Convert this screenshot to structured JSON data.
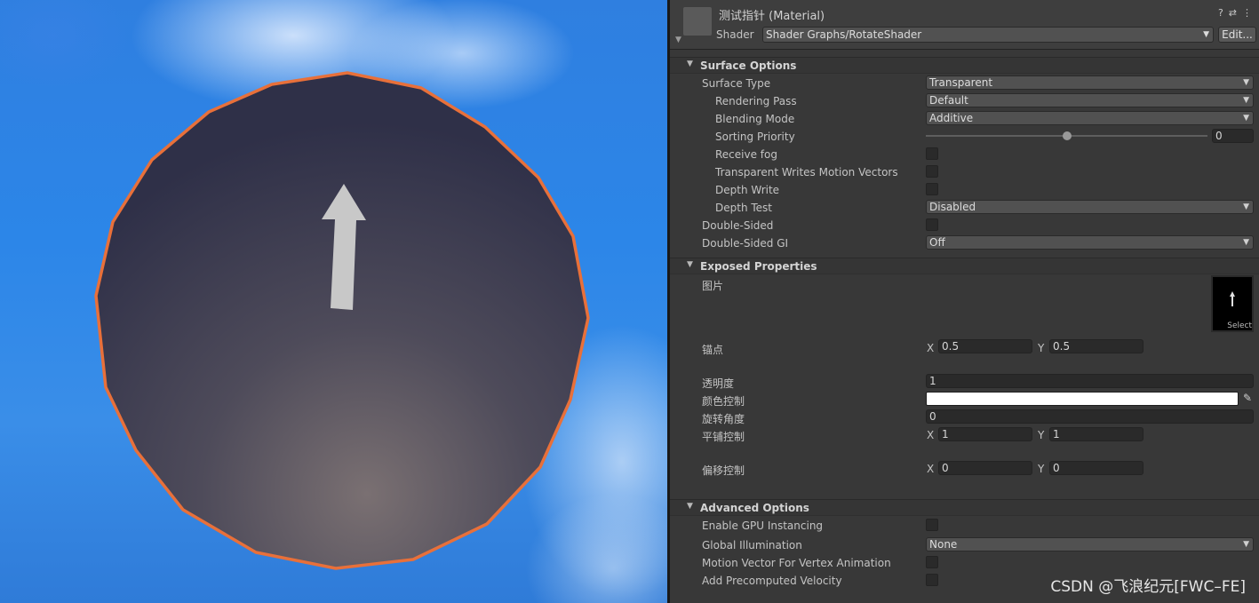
{
  "material": {
    "title": "测试指针 (Material)",
    "shader_label": "Shader",
    "shader_value": "Shader Graphs/RotateShader",
    "edit_label": "Edit...",
    "help_icon": "question-icon",
    "settings_icon": "sliders-icon",
    "menu_icon": "kebab-icon"
  },
  "surface": {
    "title": "Surface Options",
    "surface_type": {
      "label": "Surface Type",
      "value": "Transparent"
    },
    "rendering_pass": {
      "label": "Rendering Pass",
      "value": "Default"
    },
    "blending_mode": {
      "label": "Blending Mode",
      "value": "Additive"
    },
    "sorting_priority": {
      "label": "Sorting Priority",
      "value": "0",
      "slider_fraction": 0.5
    },
    "receive_fog": {
      "label": "Receive fog"
    },
    "transparent_writes": {
      "label": "Transparent Writes Motion Vectors"
    },
    "depth_write": {
      "label": "Depth Write"
    },
    "depth_test": {
      "label": "Depth Test",
      "value": "Disabled"
    },
    "double_sided": {
      "label": "Double-Sided"
    },
    "double_sided_gi": {
      "label": "Double-Sided GI",
      "value": "Off"
    }
  },
  "exposed": {
    "title": "Exposed Properties",
    "texture": {
      "label": "图片",
      "select": "Select"
    },
    "anchor": {
      "label": "锚点",
      "x_label": "X",
      "x": "0.5",
      "y_label": "Y",
      "y": "0.5"
    },
    "opacity": {
      "label": "透明度",
      "value": "1"
    },
    "color": {
      "label": "颜色控制",
      "value": "#ffffff"
    },
    "rotation": {
      "label": "旋转角度",
      "value": "0"
    },
    "tiling": {
      "label": "平铺控制",
      "x_label": "X",
      "x": "1",
      "y_label": "Y",
      "y": "1"
    },
    "offset": {
      "label": "偏移控制",
      "x_label": "X",
      "x": "0",
      "y_label": "Y",
      "y": "0"
    }
  },
  "advanced": {
    "title": "Advanced Options",
    "gpu_instancing": {
      "label": "Enable GPU Instancing"
    },
    "global_illumination": {
      "label": "Global Illumination",
      "value": "None"
    },
    "motion_vector": {
      "label": "Motion Vector For Vertex Animation"
    },
    "precomputed_velocity": {
      "label": "Add Precomputed Velocity"
    }
  },
  "watermark": "CSDN @飞浪纪元[FWC–FE]",
  "colors": {
    "outline": "#e8703a",
    "sky": "#2f84e6",
    "panel": "#383838"
  }
}
